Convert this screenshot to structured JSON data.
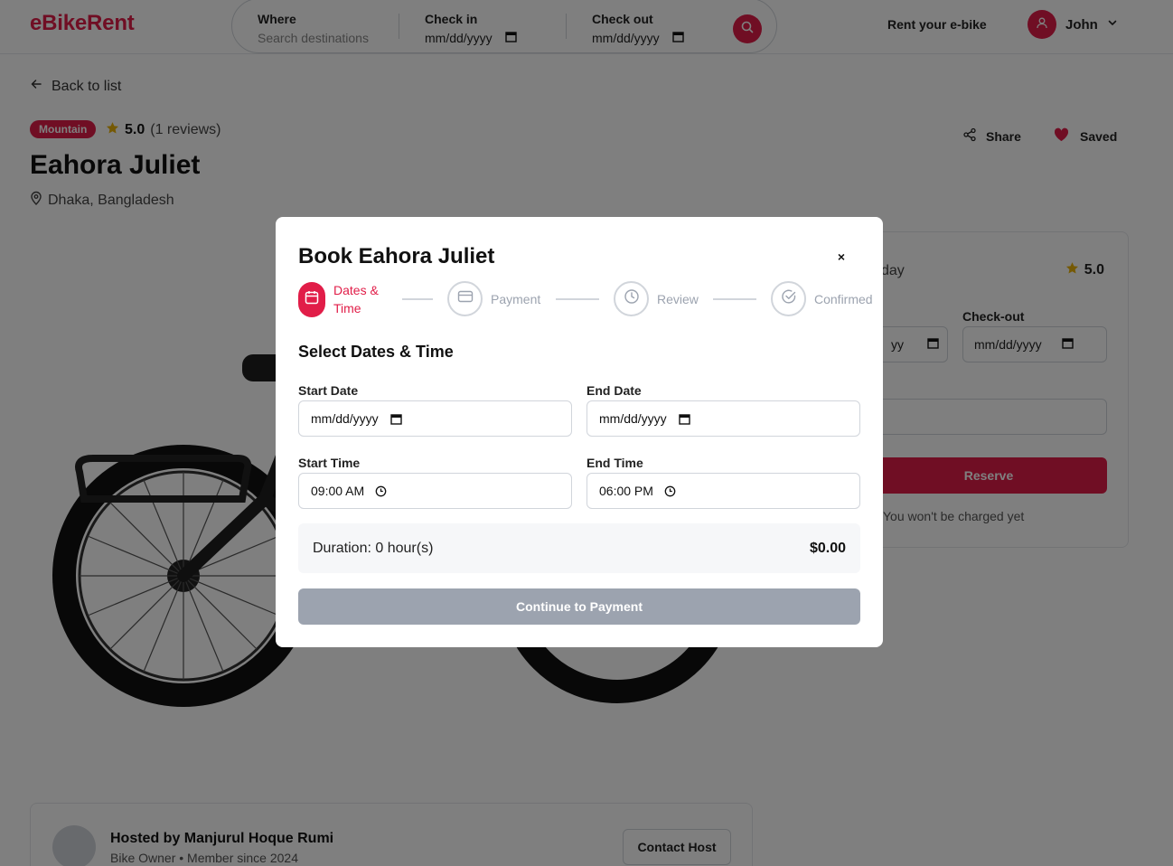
{
  "header": {
    "logo": "eBikeRent",
    "search": {
      "where_label": "Where",
      "where_placeholder": "Search destinations",
      "checkin_label": "Check in",
      "checkin_value": "mm/dd/yyyy",
      "checkout_label": "Check out",
      "checkout_value": "mm/dd/yyyy"
    },
    "rent_link": "Rent your e-bike",
    "user_name": "John"
  },
  "page": {
    "back_label": "Back to list",
    "category_tag": "Mountain",
    "rating_value": "5.0",
    "rating_reviews": "(1 reviews)",
    "title": "Eahora Juliet",
    "location": "Dhaka, Bangladesh",
    "share_label": "Share",
    "saved_label": "Saved"
  },
  "booking_card": {
    "per_day": "day",
    "rating": "5.0",
    "checkout_label": "Check-out",
    "checkin_partial": "yy",
    "checkout_value": "mm/dd/yyyy",
    "reserve_label": "Reserve",
    "note": "You won't be charged yet"
  },
  "host": {
    "name": "Hosted by Manjurul Hoque Rumi",
    "subtitle": "Bike Owner • Member since 2024",
    "contact_label": "Contact Host"
  },
  "modal": {
    "title": "Book Eahora Juliet",
    "close_symbol": "×",
    "steps": [
      {
        "label_line1": "Dates &",
        "label_line2": "Time",
        "active": true
      },
      {
        "label": "Payment",
        "active": false
      },
      {
        "label": "Review",
        "active": false
      },
      {
        "label": "Confirmed",
        "active": false
      }
    ],
    "section_title": "Select Dates & Time",
    "start_date_label": "Start Date",
    "start_date_value": "mm/dd/yyyy",
    "end_date_label": "End Date",
    "end_date_value": "mm/dd/yyyy",
    "start_time_label": "Start Time",
    "start_time_value": "09:00 AM",
    "end_time_label": "End Time",
    "end_time_value": "06:00 PM",
    "duration_text": "Duration: 0 hour(s)",
    "duration_price": "$0.00",
    "continue_label": "Continue to Payment"
  },
  "colors": {
    "brand": "#e11d48",
    "disabled_button": "#9ca3af",
    "star": "#eab308"
  },
  "icons": [
    "search-icon",
    "user-icon",
    "chevron-down-icon",
    "arrow-left-icon",
    "star-icon",
    "map-pin-icon",
    "share-icon",
    "heart-icon",
    "calendar-icon",
    "credit-card-icon",
    "clock-icon",
    "check-circle-icon",
    "close-icon"
  ]
}
